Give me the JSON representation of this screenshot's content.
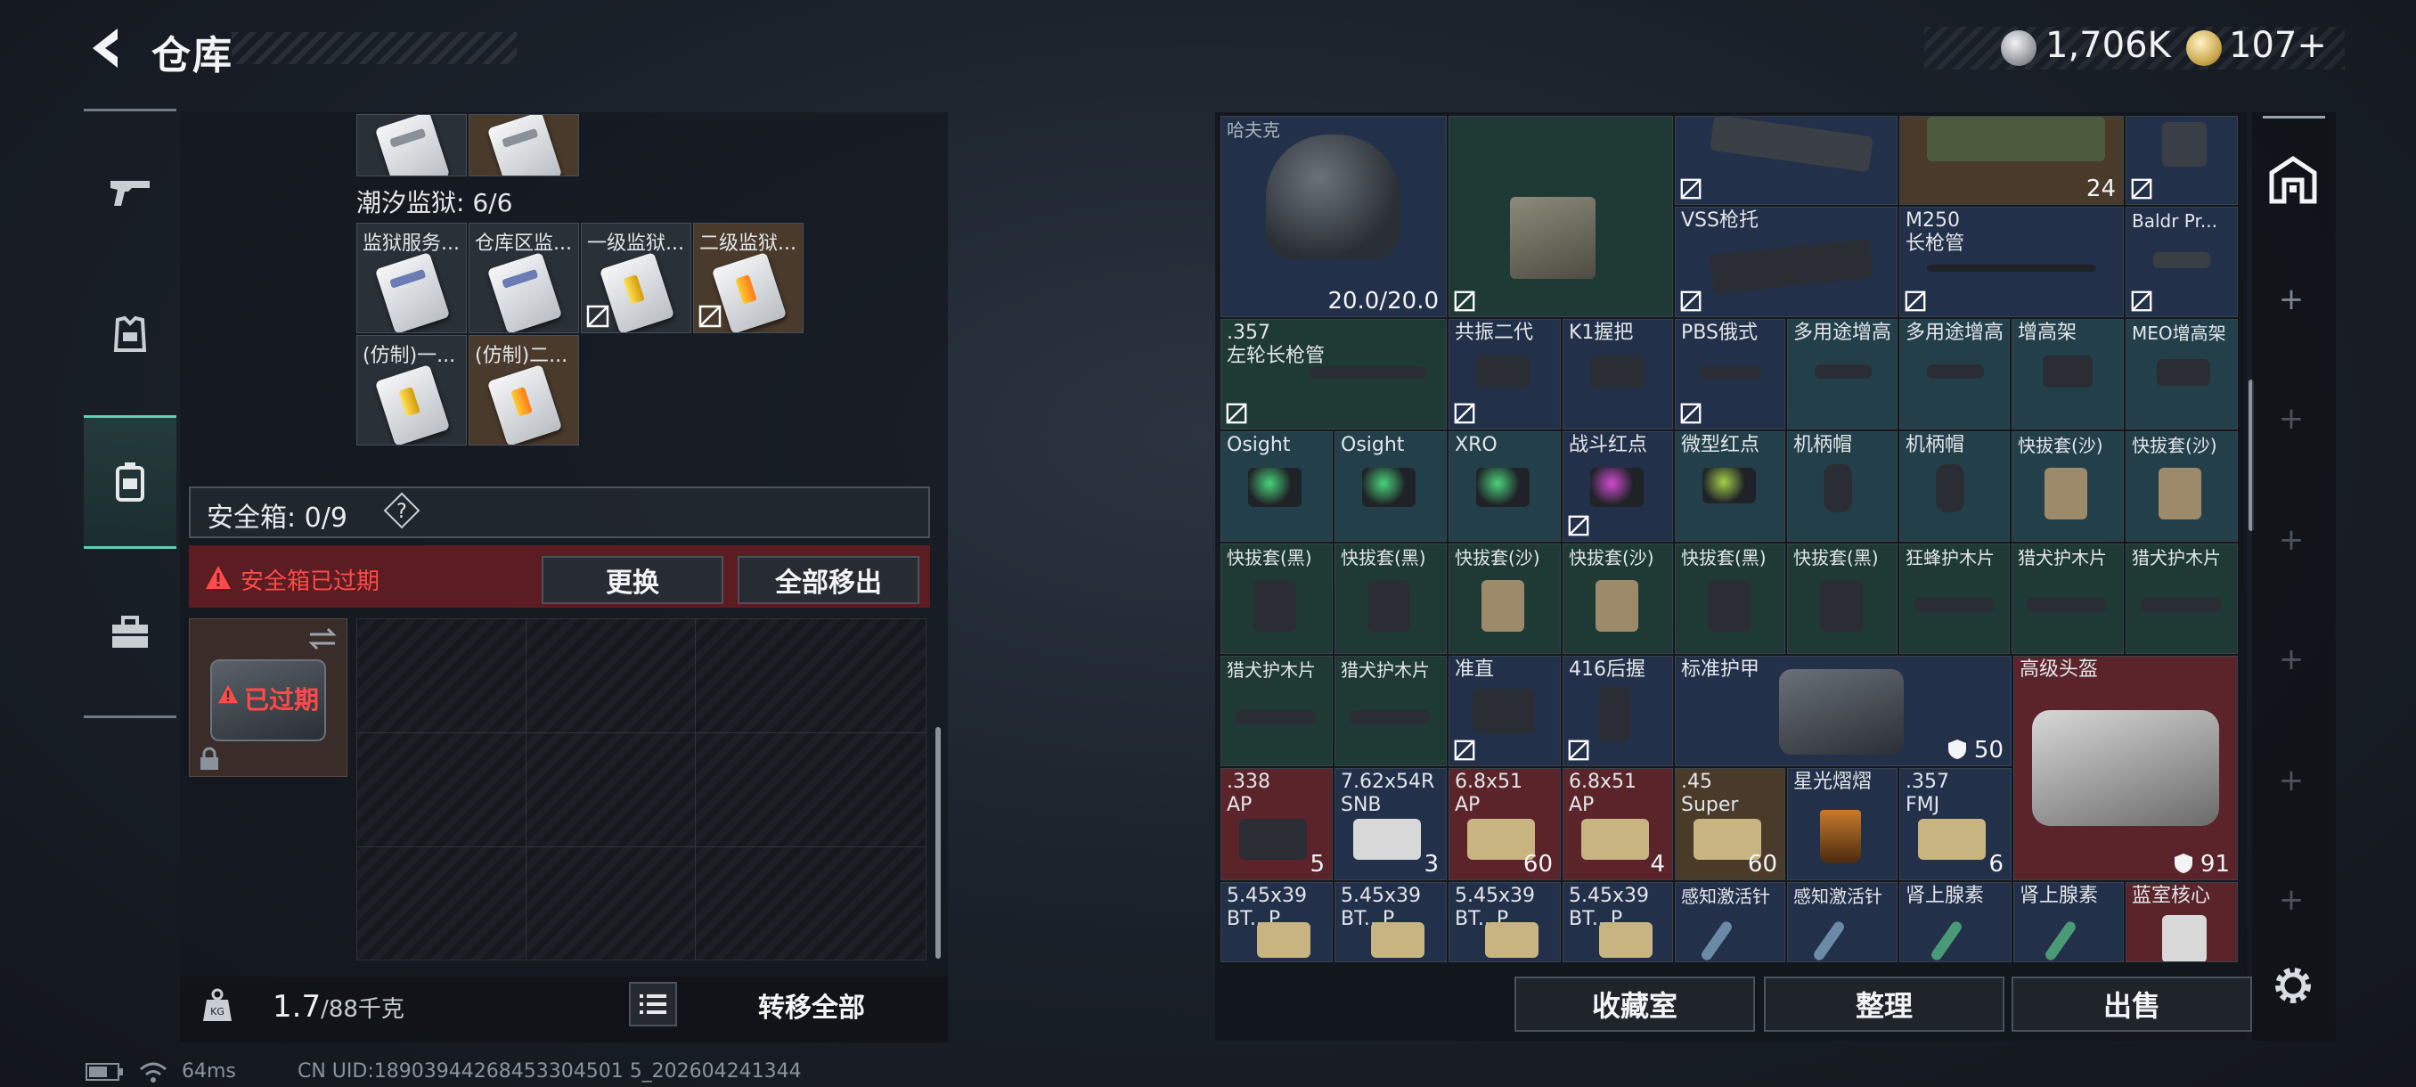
{
  "header": {
    "title": "仓库",
    "silver_amount": "1,706K",
    "gold_amount": "107+"
  },
  "left": {
    "prison_section_title": "潮汐监狱: 6/6",
    "top_items": [
      {
        "label": ""
      },
      {
        "label": ""
      }
    ],
    "prison_items": [
      {
        "label": "监狱服务..."
      },
      {
        "label": "仓库区监..."
      },
      {
        "label": "一级监狱..."
      },
      {
        "label": "二级监狱..."
      },
      {
        "label": "(仿制)一..."
      },
      {
        "label": "(仿制)二..."
      }
    ],
    "safe_label": "安全箱: 0/9",
    "help": "?",
    "expired_warning": "安全箱已过期",
    "replace_button": "更换",
    "move_all_button": "全部移出",
    "safebox_expired": "已过期",
    "weight_current": "1.7",
    "weight_max": "/88千克",
    "transfer_all": "转移全部"
  },
  "right": {
    "cells": [
      {
        "label": "哈夫克",
        "count": "20.0/20.0"
      },
      {
        "label": ""
      },
      {
        "label": ""
      },
      {
        "label": "",
        "count": "24"
      },
      {
        "label": ""
      },
      {
        "label": "VSS枪托"
      },
      {
        "label": "M250\n长枪管"
      },
      {
        "label": "Baldr Pr..."
      },
      {
        "label": ".357\n左轮长枪管"
      },
      {
        "label": "共振二代"
      },
      {
        "label": "K1握把"
      },
      {
        "label": "PBS俄式"
      },
      {
        "label": "多用途增高"
      },
      {
        "label": "多用途增高"
      },
      {
        "label": "增高架"
      },
      {
        "label": "MEO增高架"
      },
      {
        "label": "Osight"
      },
      {
        "label": "Osight"
      },
      {
        "label": "XRO"
      },
      {
        "label": "战斗红点"
      },
      {
        "label": "微型红点"
      },
      {
        "label": "机柄帽"
      },
      {
        "label": "机柄帽"
      },
      {
        "label": "快拔套(沙)"
      },
      {
        "label": "快拔套(沙)"
      },
      {
        "label": "快拔套(黑)"
      },
      {
        "label": "快拔套(黑)"
      },
      {
        "label": "快拔套(沙)"
      },
      {
        "label": "快拔套(沙)"
      },
      {
        "label": "快拔套(黑)"
      },
      {
        "label": "快拔套(黑)"
      },
      {
        "label": "狂蜂护木片"
      },
      {
        "label": "猎犬护木片"
      },
      {
        "label": "猎犬护木片"
      },
      {
        "label": "猎犬护木片"
      },
      {
        "label": "猎犬护木片"
      },
      {
        "label": "准直"
      },
      {
        "label": "416后握"
      },
      {
        "label": "标准护甲",
        "count": "50"
      },
      {
        "label": "高级头盔",
        "count": "91"
      },
      {
        "label": ".338\nAP",
        "count": "5"
      },
      {
        "label": "7.62x54R\nSNB",
        "count": "3"
      },
      {
        "label": "6.8x51\nAP",
        "count": "60"
      },
      {
        "label": "6.8x51\nAP",
        "count": "4"
      },
      {
        "label": ".45\nSuper",
        "count": "60"
      },
      {
        "label": "星光熠熠"
      },
      {
        "label": ".357\nFMJ",
        "count": "6"
      },
      {
        "label": "5.45x39\nBT...P"
      },
      {
        "label": "5.45x39\nBT...P"
      },
      {
        "label": "5.45x39\nBT...P"
      },
      {
        "label": "5.45x39\nBT...P"
      },
      {
        "label": "感知激活针"
      },
      {
        "label": "感知激活针"
      },
      {
        "label": "肾上腺素"
      },
      {
        "label": "肾上腺素"
      },
      {
        "label": "蓝室核心"
      }
    ],
    "fav_button": "收藏室",
    "sort_button": "整理",
    "sell_button": "出售"
  },
  "status": {
    "ping": "64ms",
    "uid": "CN UID:18903944268453304501 5_202604241344"
  },
  "colors": {
    "accent": "#5fd0b6",
    "warning": "#ff4a4a",
    "expired_bg": "#5b1c22"
  }
}
